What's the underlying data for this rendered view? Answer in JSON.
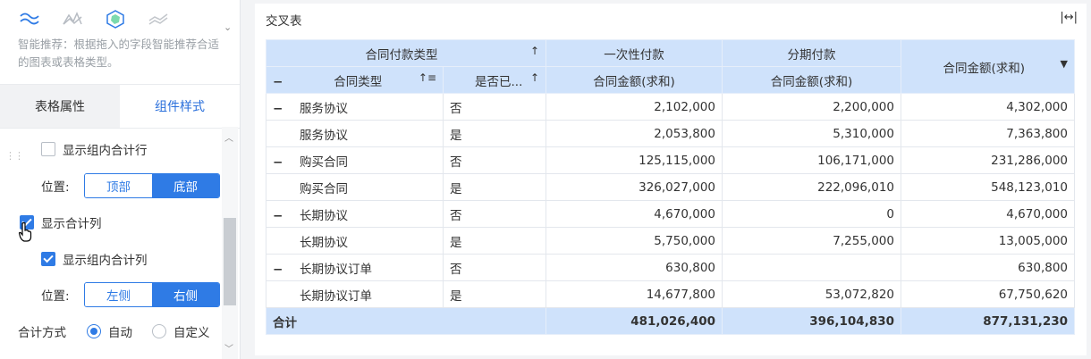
{
  "left": {
    "chart_icons": [
      "line-chart-icon",
      "area-chart-icon",
      "radar-chart-icon",
      "stacked-line-icon"
    ],
    "hint": "智能推荐：根据拖入的字段智能推荐合适的图表或表格类型。",
    "tabs": [
      "表格属性",
      "组件样式"
    ],
    "show_group_total_row": "显示组内合计行",
    "position_label": "位置:",
    "row_pos": {
      "top": "顶部",
      "bottom": "底部",
      "selected": "底部"
    },
    "show_total_col": "显示合计列",
    "show_group_total_col": "显示组内合计列",
    "col_pos": {
      "left": "左侧",
      "right": "右侧",
      "selected": "右侧"
    },
    "total_method_label": "合计方式",
    "total_method": {
      "auto": "自动",
      "custom": "自定义",
      "selected": "自动"
    },
    "checked": {
      "group_total_row": false,
      "total_col": true,
      "group_total_col": true
    }
  },
  "right": {
    "title": "交叉表",
    "header": {
      "pay_type": "合同付款类型",
      "one_time": "一次性付款",
      "installment": "分期付款",
      "total_amount": "合同金额(求和)",
      "contract_type": "合同类型",
      "is_done": "是否已...",
      "one_time_amount": "合同金额(求和)",
      "installment_amount": "合同金额(求和)"
    },
    "rows": [
      {
        "group": true,
        "type": "服务协议",
        "flag": "否",
        "a": "2,102,000",
        "b": "2,200,000",
        "c": "4,302,000"
      },
      {
        "group": false,
        "type": "服务协议",
        "flag": "是",
        "a": "2,053,800",
        "b": "5,310,000",
        "c": "7,363,800"
      },
      {
        "group": true,
        "type": "购买合同",
        "flag": "否",
        "a": "125,115,000",
        "b": "106,171,000",
        "c": "231,286,000"
      },
      {
        "group": false,
        "type": "购买合同",
        "flag": "是",
        "a": "326,027,000",
        "b": "222,096,010",
        "c": "548,123,010"
      },
      {
        "group": true,
        "type": "长期协议",
        "flag": "否",
        "a": "4,670,000",
        "b": "0",
        "c": "4,670,000"
      },
      {
        "group": false,
        "type": "长期协议",
        "flag": "是",
        "a": "5,750,000",
        "b": "7,255,000",
        "c": "13,005,000"
      },
      {
        "group": true,
        "type": "长期协议订单",
        "flag": "否",
        "a": "630,800",
        "b": "",
        "c": "630,800"
      },
      {
        "group": false,
        "type": "长期协议订单",
        "flag": "是",
        "a": "14,677,800",
        "b": "53,072,820",
        "c": "67,750,620"
      }
    ],
    "total": {
      "label": "合计",
      "a": "481,026,400",
      "b": "396,104,830",
      "c": "877,131,230"
    }
  }
}
